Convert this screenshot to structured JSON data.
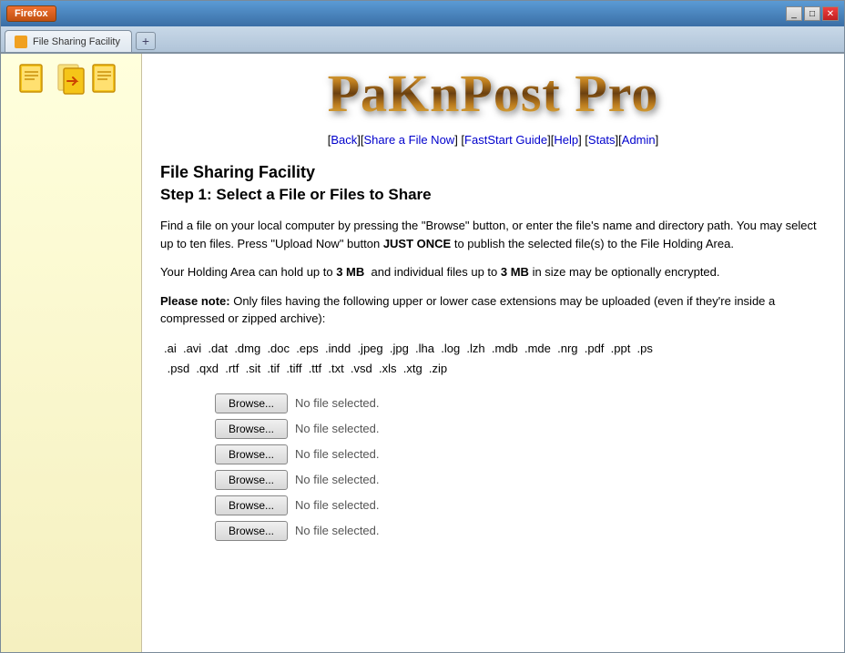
{
  "browser": {
    "title_btn": "Firefox",
    "tab_title": "File Sharing Facility",
    "new_tab_label": "+",
    "controls": [
      "_",
      "□",
      "✕"
    ]
  },
  "nav": {
    "links": [
      {
        "label": "Back",
        "href": "#"
      },
      {
        "label": "Share a File Now",
        "href": "#"
      },
      {
        "label": "FastStart Guide",
        "href": "#"
      },
      {
        "label": "Help",
        "href": "#"
      },
      {
        "label": "Stats",
        "href": "#"
      },
      {
        "label": "Admin",
        "href": "#"
      }
    ],
    "separator": "]["
  },
  "page": {
    "logo_text": "PaKnPost Pro",
    "title": "File Sharing Facility",
    "step_title": "Step 1: Select a File or Files to Share",
    "para1": "Find a file on your local computer by pressing the \"Browse\" button, or enter the file's name and directory path. You may select up to ten files. Press \"Upload Now\" button JUST ONCE to publish the selected file(s) to the File Holding Area.",
    "para1_bold": "JUST ONCE",
    "para2_prefix": "Your Holding Area can hold up to ",
    "para2_size1": "3 MB",
    "para2_mid": " and individual files up to ",
    "para2_size2": "3 MB",
    "para2_suffix": " in size may be optionally encrypted.",
    "para3_bold": "Please note:",
    "para3_text": " Only files having the following upper or lower case extensions may be uploaded (even if they're inside a compressed or zipped archive):",
    "extensions": ".ai  .avi  .dat  .dmg  .doc  .eps  .indd  .jpeg  .jpg  .lha  .log  .lzh  .mdb  .mde  .nrg  .pdf  .ppt  .ps  .psd  .qxd  .rtf  .sit  .tif  .tiff  .ttf  .txt  .vsd  .xls  .xtg  .zip",
    "file_inputs": [
      {
        "btn_label": "Browse...",
        "status": "No file selected."
      },
      {
        "btn_label": "Browse...",
        "status": "No file selected."
      },
      {
        "btn_label": "Browse...",
        "status": "No file selected."
      },
      {
        "btn_label": "Browse...",
        "status": "No file selected."
      },
      {
        "btn_label": "Browse...",
        "status": "No file selected."
      },
      {
        "btn_label": "Browse...",
        "status": "No file selected."
      }
    ]
  }
}
